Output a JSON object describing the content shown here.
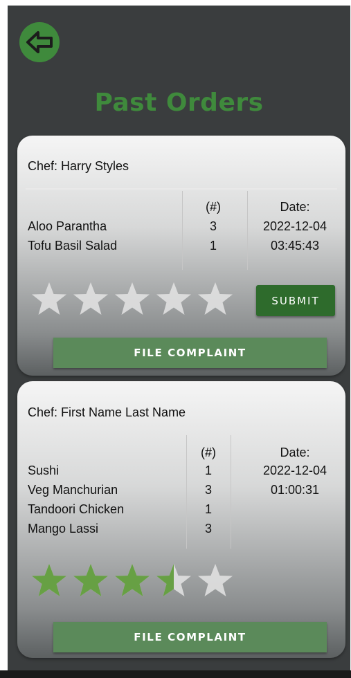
{
  "header": {
    "back_icon": "arrow-left-icon",
    "title": "Past Orders"
  },
  "colors": {
    "background": "#3a3d3e",
    "accent": "#3f8a3c",
    "submit": "#2e6b2c",
    "complaint": "#5b8a5a",
    "star_filled": "#67a044",
    "star_empty": "#e4e4e4"
  },
  "orders": [
    {
      "chef": "Chef: Harry Styles",
      "qty_header": "(#)",
      "date_header": "Date:",
      "date": "2022-12-04",
      "time": "03:45:43",
      "items": [
        {
          "name": "Aloo Parantha",
          "qty": "3"
        },
        {
          "name": "Tofu Basil Salad",
          "qty": "1"
        }
      ],
      "rating": 0,
      "rating_max": 5,
      "submit_label": "SUBMIT",
      "complaint_label": "FILE COMPLAINT"
    },
    {
      "chef": "Chef: First Name Last Name",
      "qty_header": "(#)",
      "date_header": "Date:",
      "date": "2022-12-04",
      "time": "01:00:31",
      "items": [
        {
          "name": "Sushi",
          "qty": "1"
        },
        {
          "name": "Veg Manchurian",
          "qty": "3"
        },
        {
          "name": "Tandoori Chicken",
          "qty": "1"
        },
        {
          "name": "Mango Lassi",
          "qty": "3"
        }
      ],
      "rating": 3.5,
      "rating_max": 5,
      "complaint_label": "FILE COMPLAINT"
    }
  ]
}
